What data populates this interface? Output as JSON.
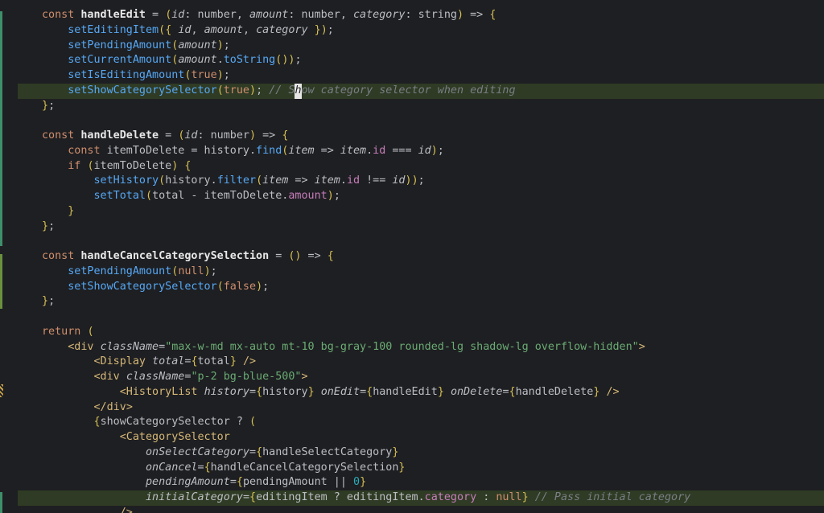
{
  "editor": {
    "lines": [
      "const handleEdit = (id: number, amount: number, category: string) => {",
      "    setEditingItem({ id, amount, category });",
      "    setPendingAmount(amount);",
      "    setCurrentAmount(amount.toString());",
      "    setIsEditingAmount(true);",
      "    setShowCategorySelector(true); // Show category selector when editing",
      "};",
      "",
      "const handleDelete = (id: number) => {",
      "    const itemToDelete = history.find(item => item.id === id);",
      "    if (itemToDelete) {",
      "        setHistory(history.filter(item => item.id !== id));",
      "        setTotal(total - itemToDelete.amount);",
      "    }",
      "};",
      "",
      "const handleCancelCategorySelection = () => {",
      "    setPendingAmount(null);",
      "    setShowCategorySelector(false);",
      "};",
      "",
      "return (",
      "    <div className=\"max-w-md mx-auto mt-10 bg-gray-100 rounded-lg shadow-lg overflow-hidden\">",
      "        <Display total={total} />",
      "        <div className=\"p-2 bg-blue-500\">",
      "            <HistoryList history={history} onEdit={handleEdit} onDelete={handleDelete} />",
      "        </div>",
      "        {showCategorySelector ? (",
      "            <CategorySelector",
      "                onSelectCategory={handleSelectCategory}",
      "                onCancel={handleCancelCategorySelection}",
      "                pendingAmount={pendingAmount || 0}",
      "                initialCategory={editingItem ? editingItem.category : null} // Pass initial category",
      "            />"
    ]
  },
  "colors": {
    "background": "#1e1f22",
    "keyword": "#cf8e6d",
    "function": "#56a8f5",
    "string": "#6aab73",
    "comment": "#7a7e85",
    "tag": "#d5b778",
    "property": "#c77dbb",
    "change_bar": "#3f8f6a"
  }
}
